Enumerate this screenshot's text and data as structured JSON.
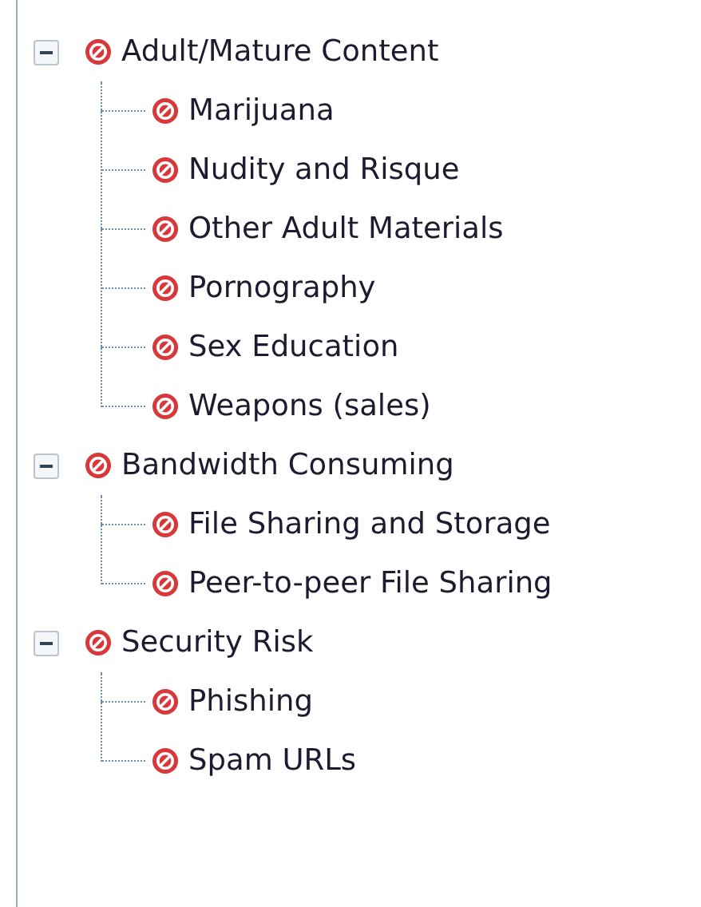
{
  "tree": [
    {
      "label": "Adult/Mature Content",
      "expanded": true,
      "children": [
        {
          "label": "Marijuana"
        },
        {
          "label": "Nudity and Risque"
        },
        {
          "label": "Other Adult Materials"
        },
        {
          "label": "Pornography"
        },
        {
          "label": "Sex Education"
        },
        {
          "label": "Weapons (sales)"
        }
      ]
    },
    {
      "label": "Bandwidth Consuming",
      "expanded": true,
      "children": [
        {
          "label": "File Sharing and Storage"
        },
        {
          "label": "Peer-to-peer File Sharing"
        }
      ]
    },
    {
      "label": "Security Risk",
      "expanded": true,
      "children": [
        {
          "label": "Phishing"
        },
        {
          "label": "Spam URLs"
        }
      ]
    }
  ]
}
